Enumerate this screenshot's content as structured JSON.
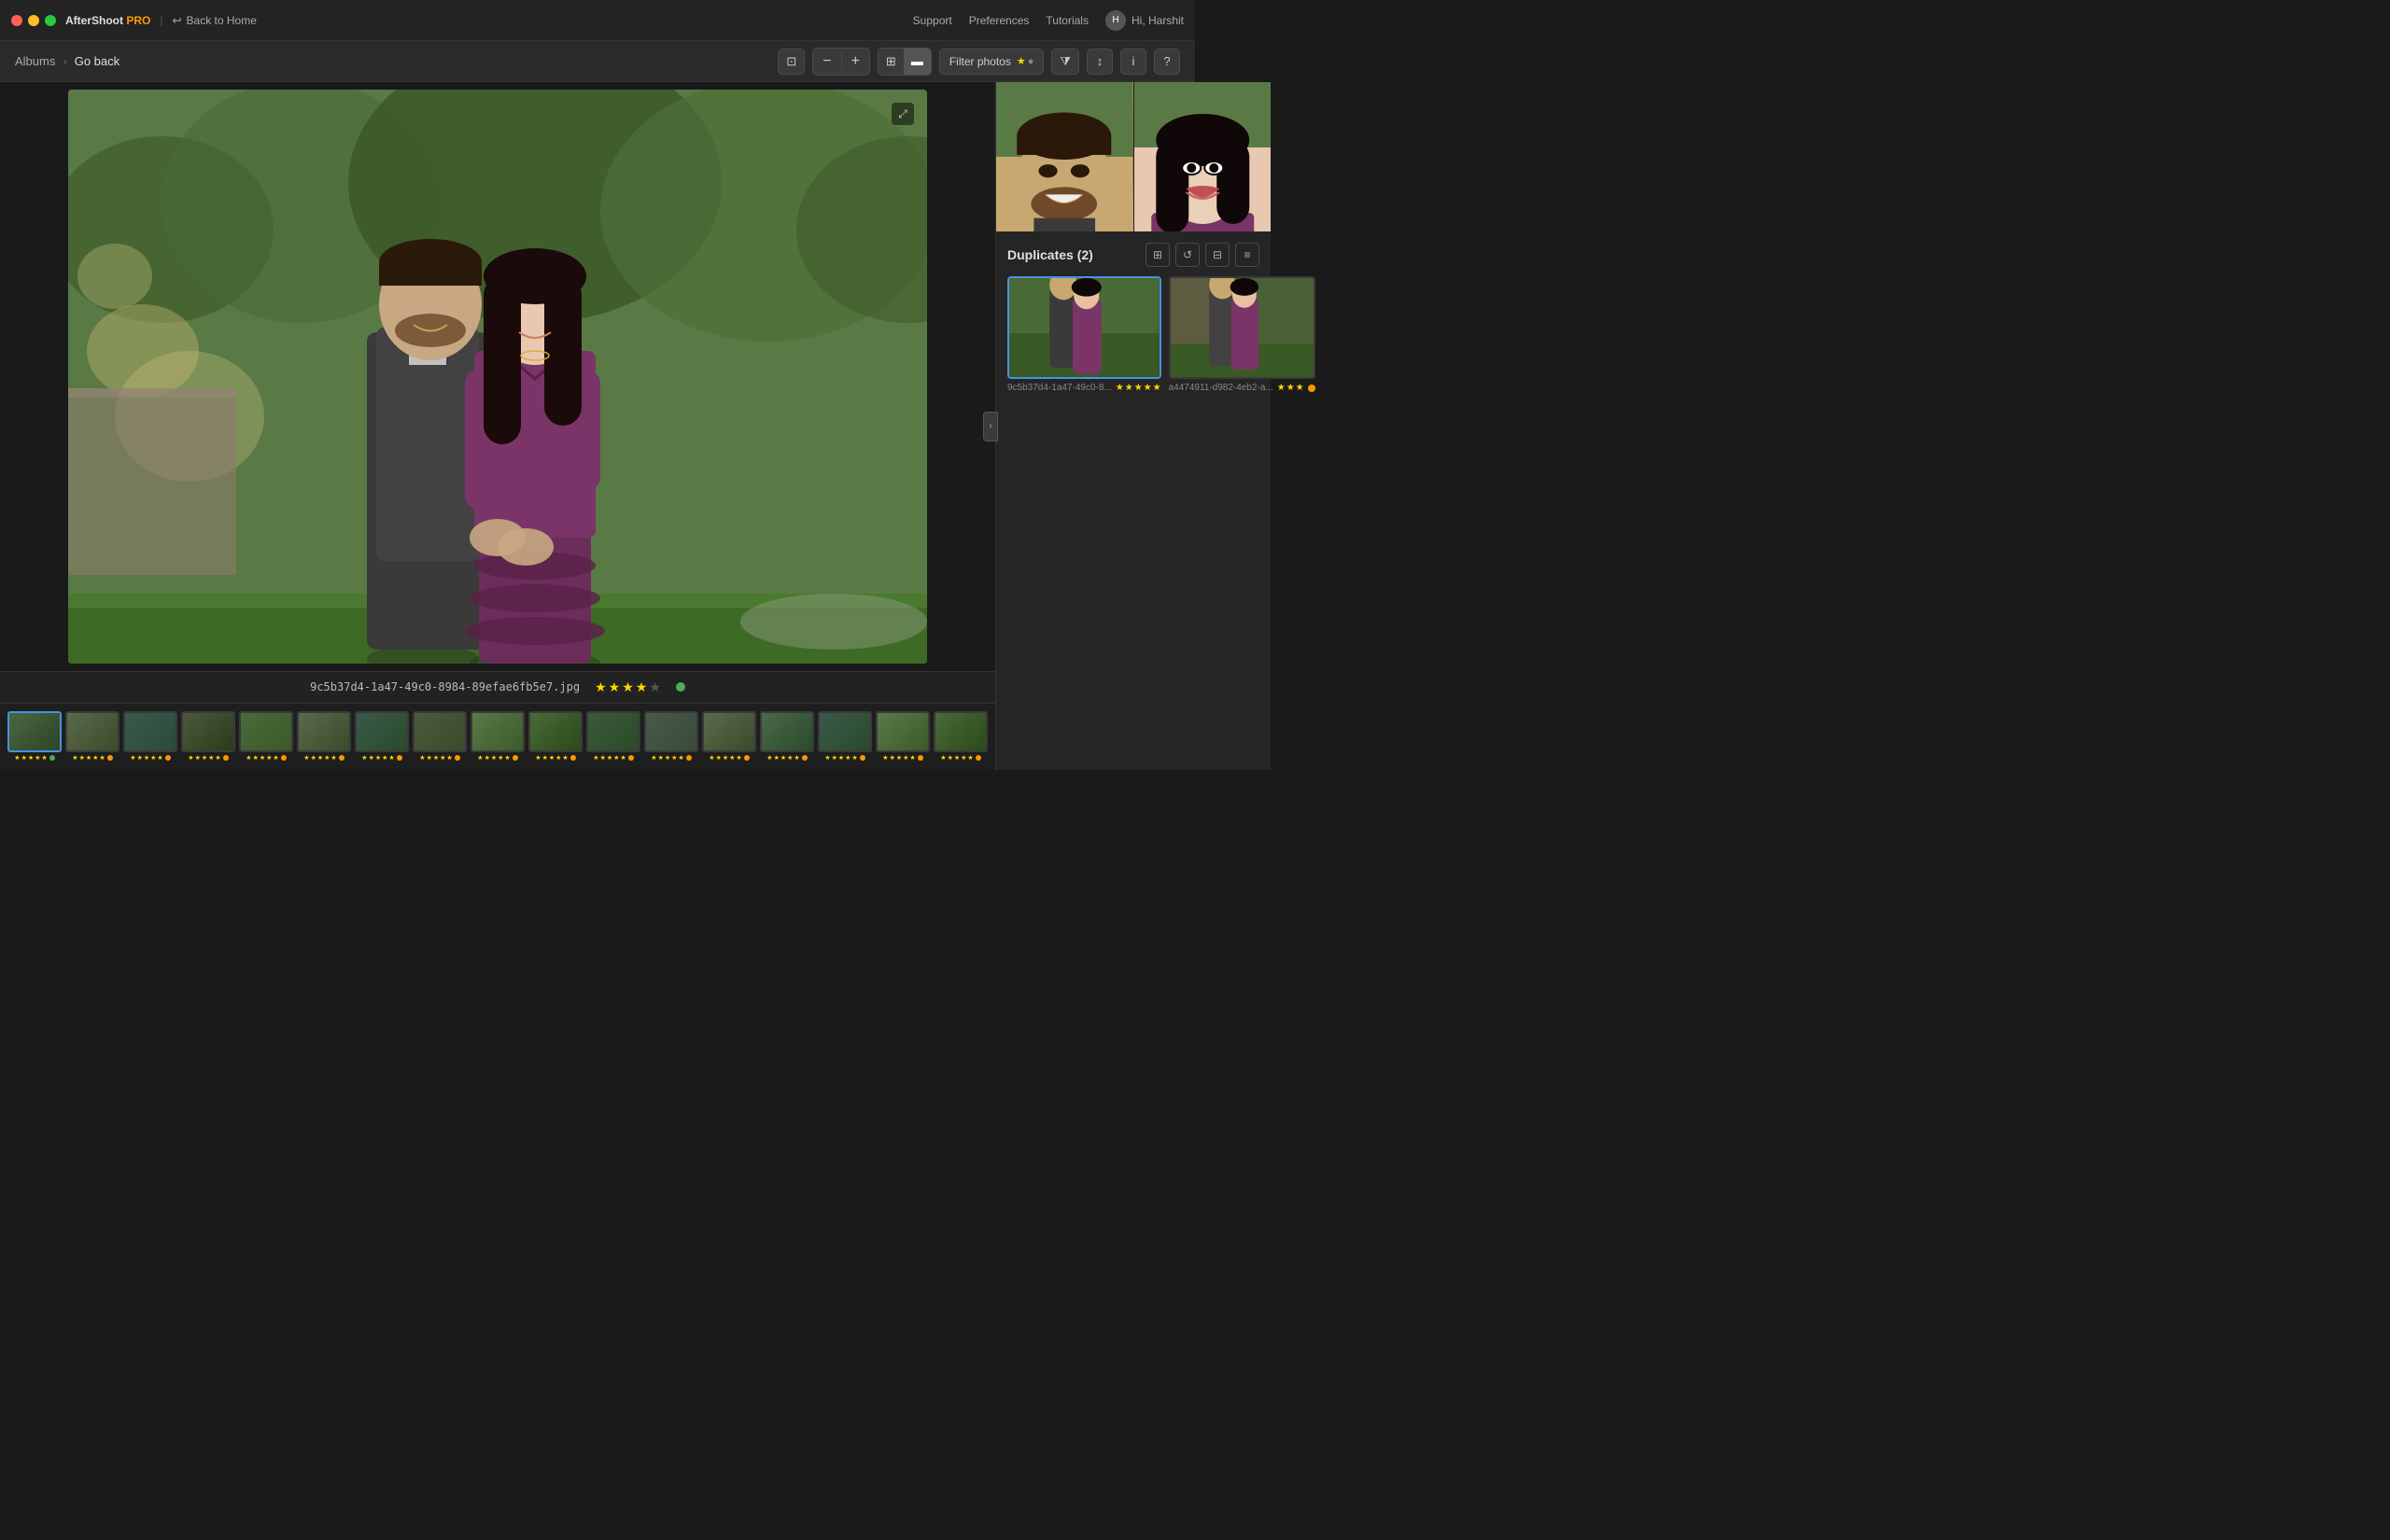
{
  "titlebar": {
    "traffic_lights": [
      "red",
      "yellow",
      "green"
    ],
    "app_name": "AfterShoot",
    "app_tier": "PRO",
    "separator": "|",
    "back_home_icon": "↩",
    "back_home_label": "Back to Home",
    "links": [
      "Support",
      "Preferences",
      "Tutorials"
    ],
    "user_greeting": "Hi, Harshit"
  },
  "toolbar": {
    "breadcrumb": {
      "albums_label": "Albums",
      "arrow": "›",
      "back_label": "Go back"
    },
    "zoom_minus": "−",
    "zoom_plus": "+",
    "view_grid_icon": "⊞",
    "view_list_icon": "▬",
    "filter_label": "Filter photos",
    "filter_star": "★",
    "filter_circle": "●",
    "funnel_icon": "⧩",
    "sort_icon": "↕",
    "info_icon": "i",
    "help_icon": "?"
  },
  "main_photo": {
    "filename": "9c5b37d4-1a47-49c0-8984-89efae6fb5e7.jpg",
    "stars": 4,
    "total_stars": 5,
    "has_dot": true,
    "dot_color": "#4caf50"
  },
  "film_strip": {
    "thumbs": [
      {
        "id": 1,
        "stars": 5,
        "dot": "green",
        "selected": true
      },
      {
        "id": 2,
        "stars": 5,
        "dot": "orange",
        "selected": false
      },
      {
        "id": 3,
        "stars": 5,
        "dot": "orange",
        "selected": false
      },
      {
        "id": 4,
        "stars": 5,
        "dot": "orange",
        "selected": false
      },
      {
        "id": 5,
        "stars": 5,
        "dot": "orange",
        "selected": false
      },
      {
        "id": 6,
        "stars": 5,
        "dot": "orange",
        "selected": false
      },
      {
        "id": 7,
        "stars": 5,
        "dot": "orange",
        "selected": false
      },
      {
        "id": 8,
        "stars": 5,
        "dot": "orange",
        "selected": false
      },
      {
        "id": 9,
        "stars": 5,
        "dot": "orange",
        "selected": false
      },
      {
        "id": 10,
        "stars": 5,
        "dot": "orange",
        "selected": false
      },
      {
        "id": 11,
        "stars": 5,
        "dot": "orange",
        "selected": false
      },
      {
        "id": 12,
        "stars": 5,
        "dot": "orange",
        "selected": false
      },
      {
        "id": 13,
        "stars": 5,
        "dot": "orange",
        "selected": false
      },
      {
        "id": 14,
        "stars": 5,
        "dot": "orange",
        "selected": false
      },
      {
        "id": 15,
        "stars": 5,
        "dot": "orange",
        "selected": false
      },
      {
        "id": 16,
        "stars": 5,
        "dot": "orange",
        "selected": false
      },
      {
        "id": 17,
        "stars": 5,
        "dot": "orange",
        "selected": false
      }
    ]
  },
  "right_panel": {
    "collapse_icon": "›",
    "duplicates_title": "Duplicates (2)",
    "duplicates": [
      {
        "filename": "9c5b37d4-1a47-49c0-8...",
        "stars": 5,
        "dot_color": "green",
        "selected": true
      },
      {
        "filename": "a4474911-d982-4eb2-a...",
        "stars": 3,
        "dot_color": "orange",
        "selected": false
      }
    ]
  }
}
